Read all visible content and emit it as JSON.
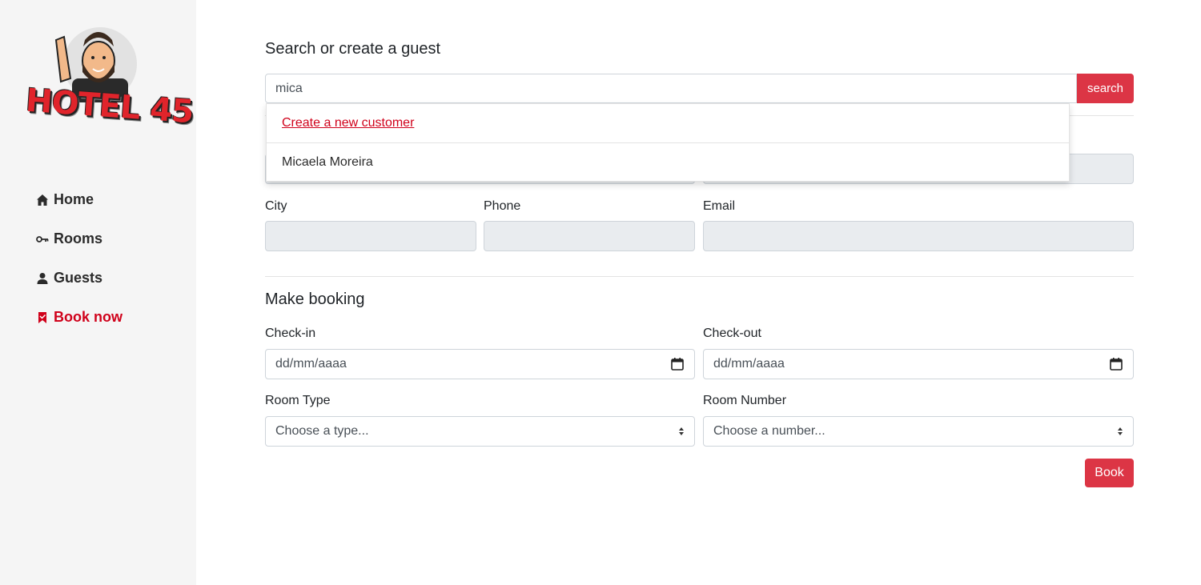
{
  "brand": {
    "logo_text": "HOTEL 45",
    "accent": "#dc3545",
    "active_color": "#d0021b"
  },
  "sidebar": {
    "items": [
      {
        "label": "Home",
        "icon": "home-icon"
      },
      {
        "label": "Rooms",
        "icon": "key-icon"
      },
      {
        "label": "Guests",
        "icon": "user-icon"
      },
      {
        "label": "Book now",
        "icon": "bookmark-icon",
        "active": true
      }
    ]
  },
  "search": {
    "title": "Search or create a guest",
    "value": "mica",
    "button_label": "search",
    "dropdown": {
      "create_label": "Create a new customer",
      "results": [
        "Micaela Moreira"
      ]
    }
  },
  "guest": {
    "city_label": "City",
    "phone_label": "Phone",
    "email_label": "Email"
  },
  "booking": {
    "title": "Make booking",
    "checkin_label": "Check-in",
    "checkin_placeholder": "dd/mm/aaaa",
    "checkout_label": "Check-out",
    "checkout_placeholder": "dd/mm/aaaa",
    "room_type_label": "Room Type",
    "room_type_value": "Choose a type...",
    "room_number_label": "Room Number",
    "room_number_value": "Choose a number...",
    "book_label": "Book"
  }
}
